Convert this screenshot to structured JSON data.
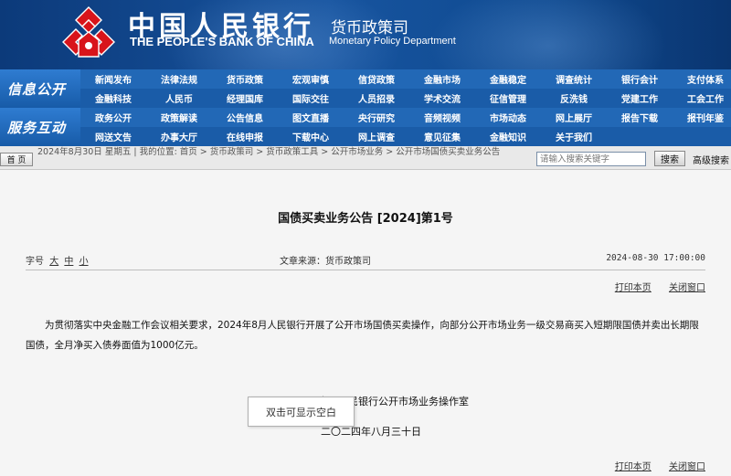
{
  "header": {
    "cn_title": "中国人民银行",
    "en_title": "THE PEOPLE'S BANK OF CHINA",
    "dept_cn": "货币政策司",
    "dept_en": "Monetary Policy Department",
    "logo_icon": "pboc-logo-icon",
    "logo_color": "#d8141a"
  },
  "nav": {
    "section_info": "信息公开",
    "section_service": "服务互动",
    "row1": [
      "新闻发布",
      "法律法规",
      "货币政策",
      "宏观审慎",
      "信贷政策",
      "金融市场",
      "金融稳定",
      "调查统计",
      "银行会计",
      "支付体系"
    ],
    "row2": [
      "金融科技",
      "人民币",
      "经理国库",
      "国际交往",
      "人员招录",
      "学术交流",
      "征信管理",
      "反洗钱",
      "党建工作",
      "工会工作"
    ],
    "row3": [
      "政务公开",
      "政策解读",
      "公告信息",
      "图文直播",
      "央行研究",
      "音频视频",
      "市场动态",
      "网上展厅",
      "报告下载",
      "报刊年鉴"
    ],
    "row4": [
      "网送文告",
      "办事大厅",
      "在线申报",
      "下载中心",
      "网上调查",
      "意见征集",
      "金融知识",
      "关于我们"
    ]
  },
  "breadcrumb": {
    "home_label": "首 页",
    "text": "2024年8月30日 星期五 | 我的位置: 首页 > 货币政策司 > 货币政策工具 > 公开市场业务 > 公开市场国债买卖业务公告",
    "search_placeholder": "请输入搜索关键字",
    "search_label": "搜索",
    "advanced_label": "高级搜索"
  },
  "article": {
    "title": "国债买卖业务公告 [2024]第1号",
    "font_size_label": "字号",
    "font_sizes": [
      "大",
      "中",
      "小"
    ],
    "source": "文章来源：货币政策司",
    "datetime": "2024-08-30 17:00:00",
    "print_label": "打印本页",
    "close_label": "关闭窗口",
    "body": "为贯彻落实中央金融工作会议相关要求，2024年8月人民银行开展了公开市场国债买卖操作，向部分公开市场业务一级交易商买入短期限国债并卖出长期限国债，全月净买入债券面值为1000亿元。",
    "signature": "中国人民银行公开市场业务操作室",
    "sign_date": "二〇二四年八月三十日"
  },
  "tooltip": {
    "text": "双击可显示空白"
  }
}
